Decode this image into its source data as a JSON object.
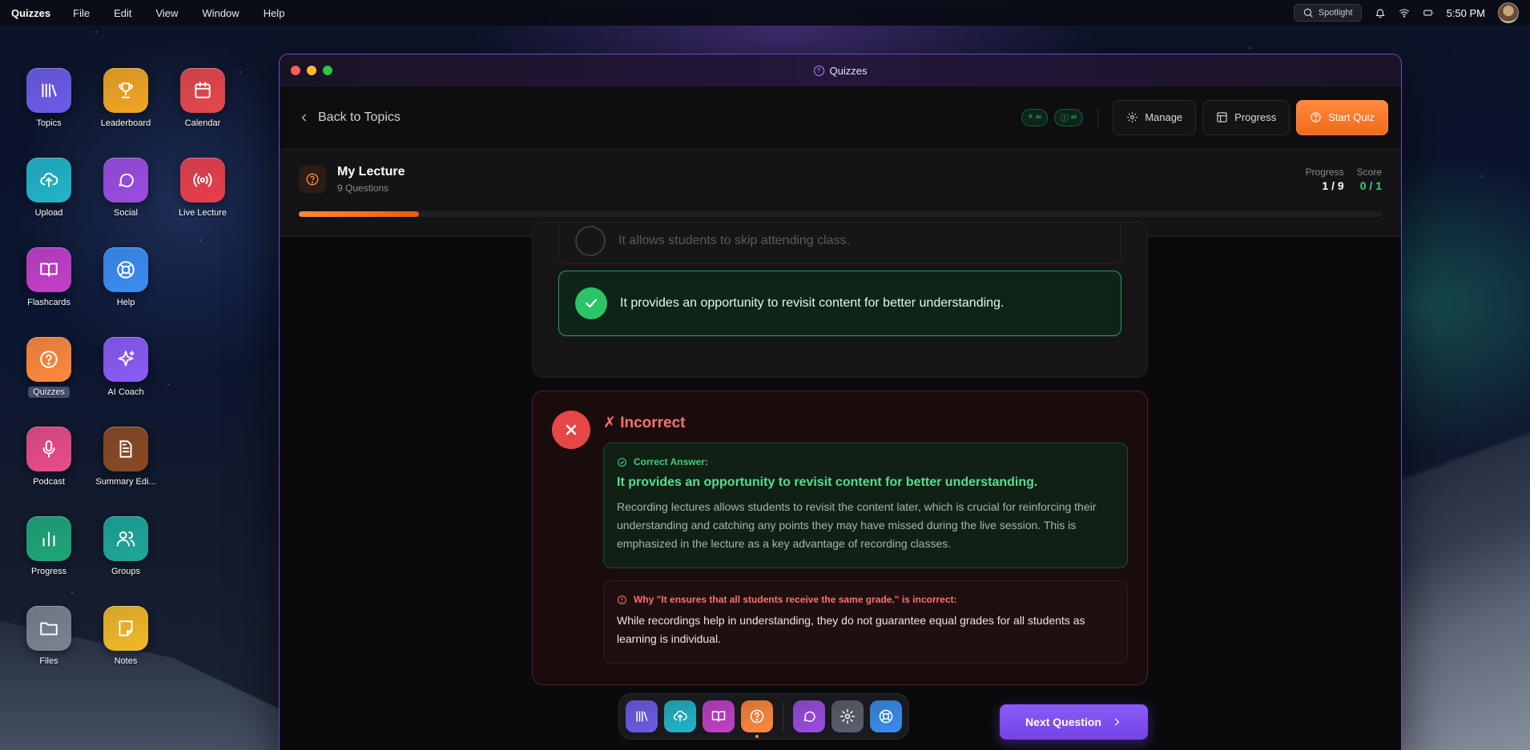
{
  "menubar": {
    "app_name": "Quizzes",
    "items": [
      "File",
      "Edit",
      "View",
      "Window",
      "Help"
    ],
    "spotlight_label": "Spotlight",
    "time": "5:50 PM"
  },
  "desktop_icons": [
    {
      "label": "Topics",
      "icon": "library-icon",
      "color": "#6d5ce8"
    },
    {
      "label": "Leaderboard",
      "icon": "trophy-icon",
      "color": "#f2a623"
    },
    {
      "label": "Calendar",
      "icon": "calendar-icon",
      "color": "#e5484d"
    },
    {
      "label": "Upload",
      "icon": "cloud-upload-icon",
      "color": "#22b5c9"
    },
    {
      "label": "Social",
      "icon": "chat-icon",
      "color": "#9b4de0"
    },
    {
      "label": "Live Lecture",
      "icon": "broadcast-icon",
      "color": "#e83f4a"
    },
    {
      "label": "Flashcards",
      "icon": "book-icon",
      "color": "#c340c9"
    },
    {
      "label": "Help",
      "icon": "lifebuoy-icon",
      "color": "#3a8ef0"
    },
    {
      "label": "Quizzes",
      "icon": "question-icon",
      "color": "#ff8a3d"
    },
    {
      "label": "AI Coach",
      "icon": "sparkle-icon",
      "color": "#8b5cf6"
    },
    {
      "label": "Podcast",
      "icon": "microphone-icon",
      "color": "#ea4c89"
    },
    {
      "label": "Summary Edi...",
      "icon": "document-icon",
      "color": "#8a4a24"
    },
    {
      "label": "Progress",
      "icon": "bar-chart-icon",
      "color": "#1fa67a"
    },
    {
      "label": "Groups",
      "icon": "users-icon",
      "color": "#1ea89a"
    },
    {
      "label": "Files",
      "icon": "folder-icon",
      "color": "#7a8290"
    },
    {
      "label": "Notes",
      "icon": "note-icon",
      "color": "#f2b928"
    }
  ],
  "window": {
    "title": "Quizzes",
    "back_label": "Back to Topics",
    "pill_1": "∞",
    "pill_2": "∞",
    "manage_label": "Manage",
    "progress_label": "Progress",
    "start_quiz_label": "Start Quiz"
  },
  "lecture": {
    "title": "My Lecture",
    "subtitle": "9 Questions",
    "progress_label": "Progress",
    "progress_value": "1 / 9",
    "score_label": "Score",
    "score_value": "0 / 1",
    "progress_fraction": 0.111
  },
  "question": {
    "faded_option": "It allows students to skip attending class.",
    "correct_option": "It provides an opportunity to revisit content for better understanding."
  },
  "feedback": {
    "title": "✗ Incorrect",
    "correct_answer_heading": "Correct Answer:",
    "correct_answer": "It provides an opportunity to revisit content for better understanding.",
    "explanation": "Recording lectures allows students to revisit the content later, which is crucial for reinforcing their understanding and catching any points they may have missed during the live session. This is emphasized in the lecture as a key advantage of recording classes.",
    "why_heading": "Why \"It ensures that all students receive the same grade.\" is incorrect:",
    "why_body": "While recordings help in understanding, they do not guarantee equal grades for all students as learning is individual."
  },
  "next_button": "Next Question",
  "dock": [
    {
      "icon": "library-icon",
      "color": "#6d5ce8"
    },
    {
      "icon": "cloud-upload-icon",
      "color": "#22b5c9"
    },
    {
      "icon": "book-icon",
      "color": "#c340c9"
    },
    {
      "icon": "question-icon",
      "color": "#ff8a3d",
      "active": true
    },
    {
      "icon": "chat-icon",
      "color": "#9b4de0"
    },
    {
      "icon": "gear-icon",
      "color": "#5a5f6b"
    },
    {
      "icon": "lifebuoy-icon",
      "color": "#3a8ef0"
    }
  ]
}
